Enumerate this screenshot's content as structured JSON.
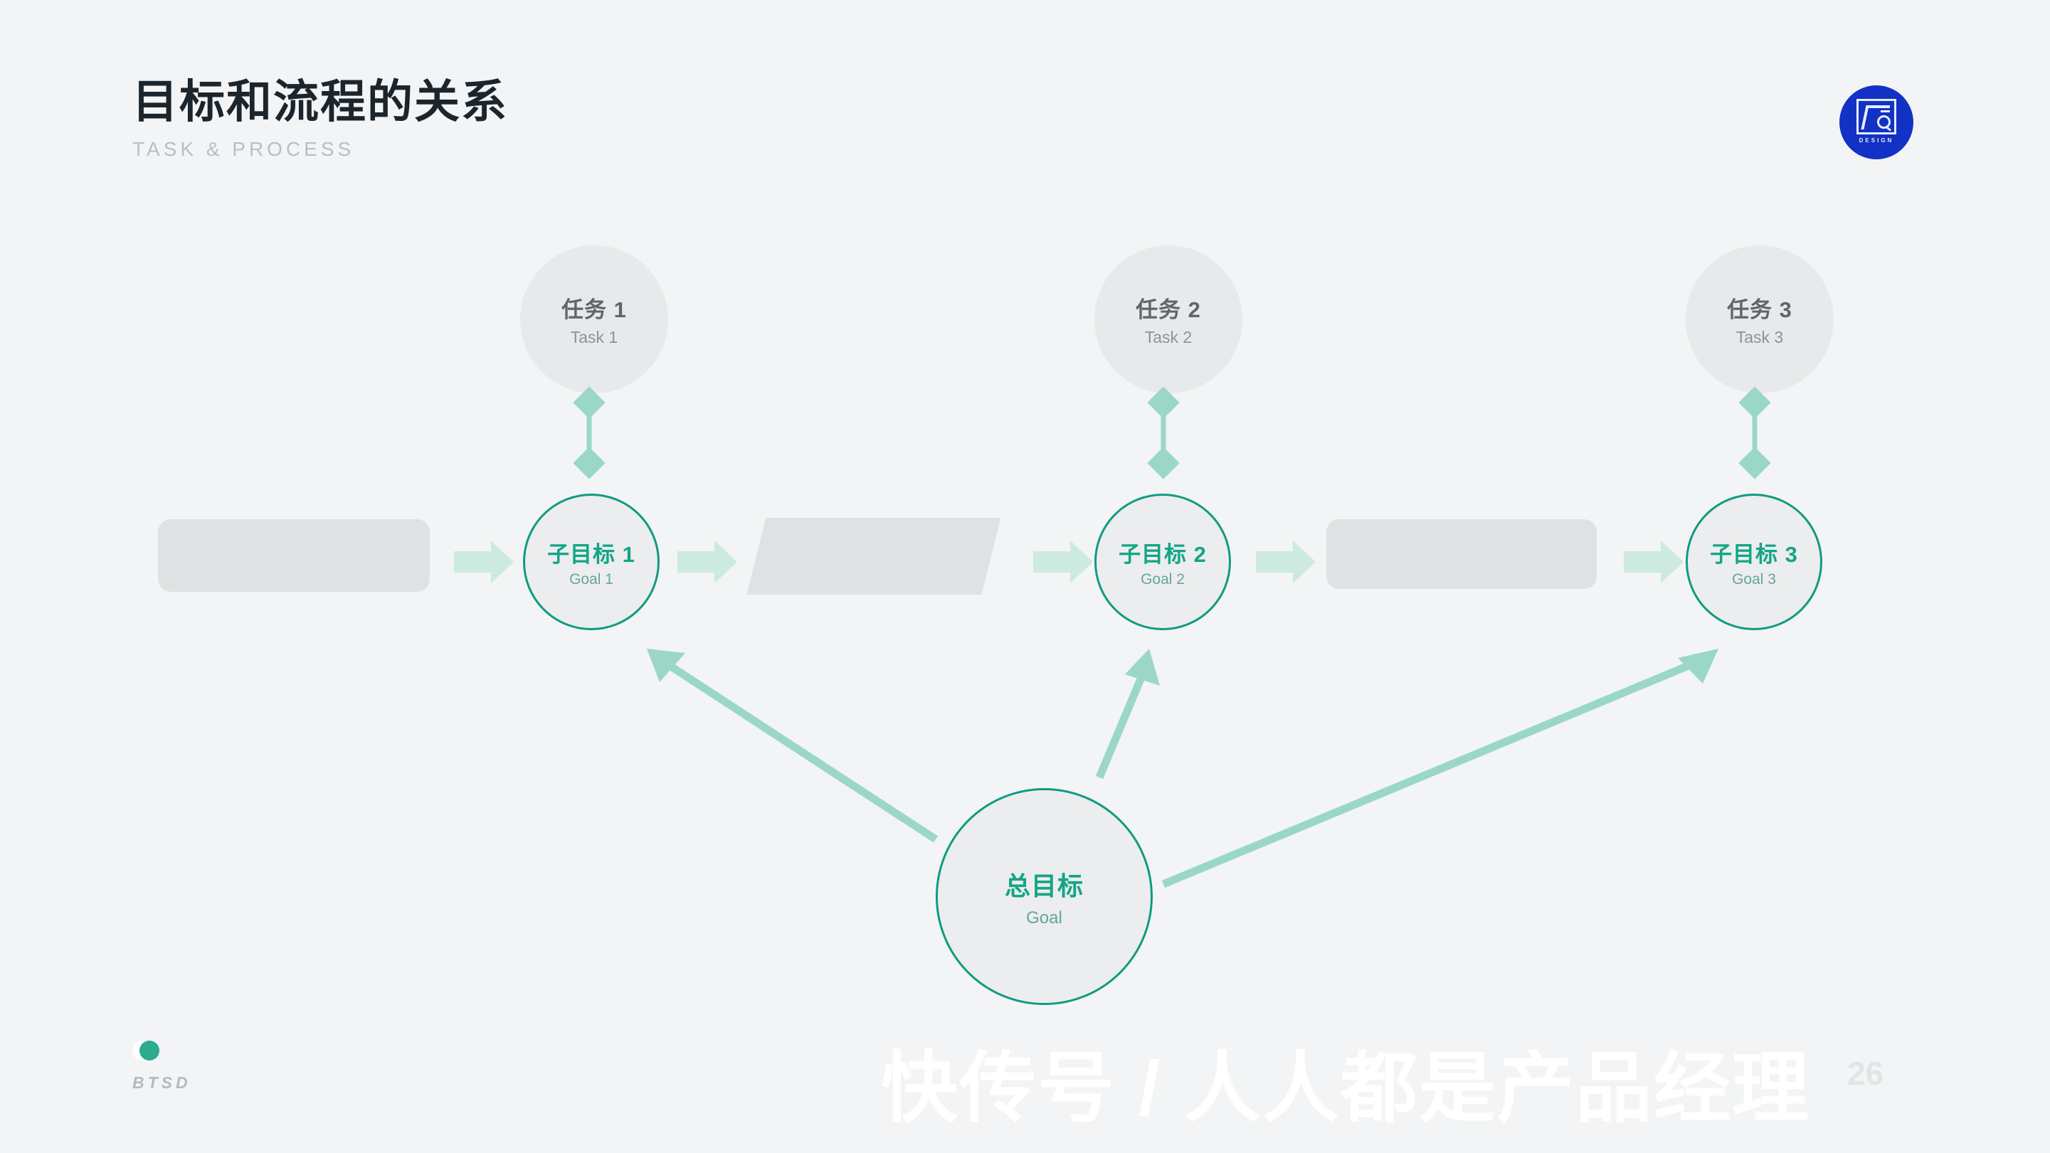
{
  "header": {
    "title": "目标和流程的关系",
    "subtitle": "TASK & PROCESS"
  },
  "logo": {
    "word": "DESIGN"
  },
  "colors": {
    "background": "#f2f4f5",
    "title": "#1c252c",
    "subtitle": "#b9bec2",
    "teal_dark": "#0f9b81",
    "teal_text": "#13a586",
    "teal_light": "#9ad7c6",
    "arrow_fill": "#cdeade",
    "gray_shape": "#e0e1e2",
    "task_fill": "#e7e9ea",
    "logo_blue": "#1132c4"
  },
  "tasks": [
    {
      "cn": "任务 1",
      "en": "Task 1"
    },
    {
      "cn": "任务 2",
      "en": "Task 2"
    },
    {
      "cn": "任务 3",
      "en": "Task 3"
    }
  ],
  "goals": [
    {
      "cn": "子目标 1",
      "en": "Goal 1"
    },
    {
      "cn": "子目标 2",
      "en": "Goal 2"
    },
    {
      "cn": "子目标 3",
      "en": "Goal 3"
    }
  ],
  "main_goal": {
    "cn": "总目标",
    "en": "Goal"
  },
  "process_blocks": [
    {
      "shape": "rounded-rect"
    },
    {
      "shape": "parallelogram"
    },
    {
      "shape": "rounded-rect"
    }
  ],
  "footer": {
    "brand": "BTSD",
    "page_number": "26"
  },
  "watermark": {
    "text": "快传号 / 人人都是产品经理"
  }
}
